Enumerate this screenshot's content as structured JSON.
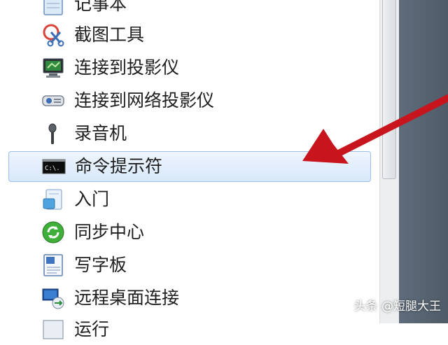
{
  "menu": {
    "items": [
      {
        "label": "记事本",
        "icon": "notepad-icon"
      },
      {
        "label": "截图工具",
        "icon": "snipping-tool-icon"
      },
      {
        "label": "连接到投影仪",
        "icon": "projector-monitor-icon"
      },
      {
        "label": "连接到网络投影仪",
        "icon": "network-projector-icon"
      },
      {
        "label": "录音机",
        "icon": "microphone-icon"
      },
      {
        "label": "命令提示符",
        "icon": "command-prompt-icon",
        "selected": true
      },
      {
        "label": "入门",
        "icon": "getting-started-icon"
      },
      {
        "label": "同步中心",
        "icon": "sync-center-icon"
      },
      {
        "label": "写字板",
        "icon": "wordpad-icon"
      },
      {
        "label": "远程桌面连接",
        "icon": "remote-desktop-icon"
      },
      {
        "label": "运行",
        "icon": "run-icon"
      }
    ]
  },
  "command_prompt_icon_text": "C:\\.",
  "annotation": {
    "type": "red-arrow",
    "color": "#c8141c",
    "points_to": "命令提示符"
  },
  "watermark": "头条 @短腿大王"
}
